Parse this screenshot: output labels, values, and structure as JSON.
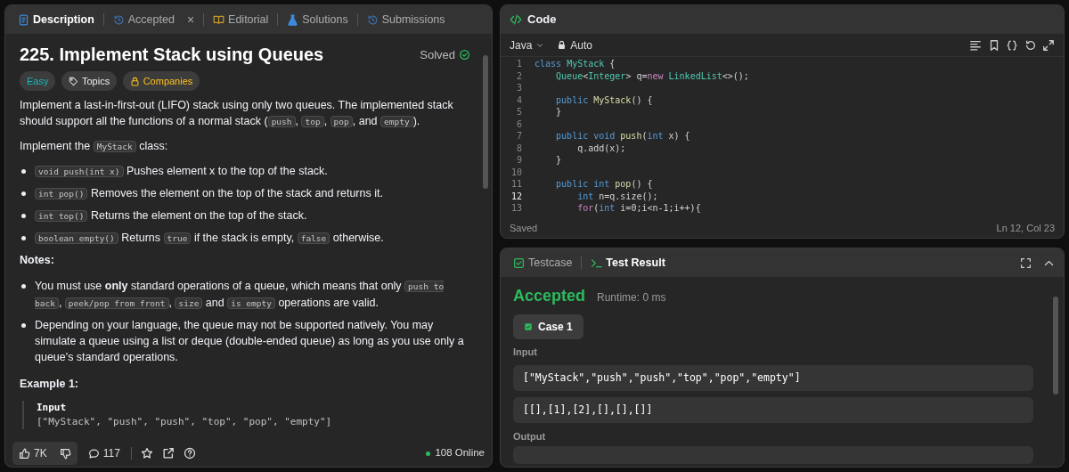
{
  "left_panel": {
    "tabs": [
      {
        "label": "Description",
        "selected": true
      },
      {
        "label": "Accepted",
        "selected": false,
        "close": "×"
      },
      {
        "label": "Editorial",
        "selected": false
      },
      {
        "label": "Solutions",
        "selected": false
      },
      {
        "label": "Submissions",
        "selected": false
      }
    ],
    "title": "225. Implement Stack using Queues",
    "status": "Solved",
    "tags": [
      {
        "label": "Easy",
        "kind": "difficulty"
      },
      {
        "label": "Topics",
        "kind": "topics"
      },
      {
        "label": "Companies",
        "kind": "companies"
      }
    ],
    "content": [
      {
        "kind": "paragraph",
        "segments": [
          {
            "kind": "text",
            "text": "Implement a last-in-first-out (LIFO) stack using only two queues. The implemented stack should support all the functions of a normal stack ("
          },
          {
            "kind": "code",
            "text": "push"
          },
          {
            "kind": "text",
            "text": ", "
          },
          {
            "kind": "code",
            "text": "top"
          },
          {
            "kind": "text",
            "text": ", "
          },
          {
            "kind": "code",
            "text": "pop"
          },
          {
            "kind": "text",
            "text": ", and "
          },
          {
            "kind": "code",
            "text": "empty"
          },
          {
            "kind": "text",
            "text": ")."
          }
        ]
      },
      {
        "kind": "paragraph",
        "segments": [
          {
            "kind": "text",
            "text": "Implement the "
          },
          {
            "kind": "code",
            "text": "MyStack"
          },
          {
            "kind": "text",
            "text": " class:"
          }
        ]
      },
      {
        "kind": "bullet",
        "segments": [
          {
            "kind": "code",
            "text": "void push(int x)"
          },
          {
            "kind": "text",
            "text": " Pushes element x to the top of the stack."
          }
        ]
      },
      {
        "kind": "bullet",
        "segments": [
          {
            "kind": "code",
            "text": "int pop()"
          },
          {
            "kind": "text",
            "text": " Removes the element on the top of the stack and returns it."
          }
        ]
      },
      {
        "kind": "bullet",
        "segments": [
          {
            "kind": "code",
            "text": "int top()"
          },
          {
            "kind": "text",
            "text": " Returns the element on the top of the stack."
          }
        ]
      },
      {
        "kind": "bullet",
        "segments": [
          {
            "kind": "code",
            "text": "boolean empty()"
          },
          {
            "kind": "text",
            "text": " Returns "
          },
          {
            "kind": "code",
            "text": "true"
          },
          {
            "kind": "text",
            "text": " if the stack is empty, "
          },
          {
            "kind": "code",
            "text": "false"
          },
          {
            "kind": "text",
            "text": " otherwise."
          }
        ]
      },
      {
        "kind": "heading",
        "text": "Notes:"
      },
      {
        "kind": "bullet",
        "segments": [
          {
            "kind": "text",
            "text": "You must use **only** standard operations of a queue, which means that only "
          },
          {
            "kind": "code",
            "text": "push to back"
          },
          {
            "kind": "text",
            "text": ", "
          },
          {
            "kind": "code",
            "text": "peek/pop from front"
          },
          {
            "kind": "text",
            "text": ", "
          },
          {
            "kind": "code",
            "text": "size"
          },
          {
            "kind": "text",
            "text": " and "
          },
          {
            "kind": "code",
            "text": "is empty"
          },
          {
            "kind": "text",
            "text": " operations are valid."
          }
        ]
      },
      {
        "kind": "bullet",
        "segments": [
          {
            "kind": "text",
            "text": "Depending on your language, the queue may not be supported natively. You may simulate a queue using a list or deque (double-ended queue) as long as you use only a queue's standard operations."
          }
        ]
      },
      {
        "kind": "heading",
        "text": "Example 1:"
      },
      {
        "kind": "example",
        "label": "Input",
        "value": "[\"MyStack\", \"push\", \"push\", \"top\", \"pop\", \"empty\"]"
      }
    ],
    "footer": {
      "likes": "7K",
      "comments": "117",
      "online": "108 Online"
    }
  },
  "code_panel": {
    "title": "Code",
    "language": "Java",
    "mode": "Auto",
    "lines": [
      {
        "number": "1",
        "current": false,
        "tokens": [
          {
            "kind": "keyword",
            "text": "class "
          },
          {
            "kind": "type",
            "text": "MyStack"
          },
          {
            "kind": "plain",
            "text": " {"
          }
        ]
      },
      {
        "number": "2",
        "current": false,
        "tokens": [
          {
            "kind": "type",
            "text": "    Queue"
          },
          {
            "kind": "plain",
            "text": "<"
          },
          {
            "kind": "type",
            "text": "Integer"
          },
          {
            "kind": "plain",
            "text": "> q="
          },
          {
            "kind": "control",
            "text": "new "
          },
          {
            "kind": "type",
            "text": "LinkedList"
          },
          {
            "kind": "plain",
            "text": "<>();"
          }
        ]
      },
      {
        "number": "3",
        "current": false
      },
      {
        "number": "4",
        "current": false,
        "tokens": [
          {
            "kind": "keyword",
            "text": "    public "
          },
          {
            "kind": "function",
            "text": "MyStack"
          },
          {
            "kind": "plain",
            "text": "() {"
          }
        ]
      },
      {
        "number": "5",
        "current": false,
        "tokens": [
          {
            "kind": "plain",
            "text": "    }"
          }
        ]
      },
      {
        "number": "6",
        "current": false
      },
      {
        "number": "7",
        "current": false,
        "tokens": [
          {
            "kind": "keyword",
            "text": "    public void "
          },
          {
            "kind": "function",
            "text": "push"
          },
          {
            "kind": "plain",
            "text": "("
          },
          {
            "kind": "keyword",
            "text": "int"
          },
          {
            "kind": "plain",
            "text": " x) {"
          }
        ]
      },
      {
        "number": "8",
        "current": false,
        "tokens": [
          {
            "kind": "plain",
            "text": "        q.add(x);"
          }
        ]
      },
      {
        "number": "9",
        "current": false,
        "tokens": [
          {
            "kind": "plain",
            "text": "    }"
          }
        ]
      },
      {
        "number": "10",
        "current": false
      },
      {
        "number": "11",
        "current": false,
        "tokens": [
          {
            "kind": "keyword",
            "text": "    public int "
          },
          {
            "kind": "function",
            "text": "pop"
          },
          {
            "kind": "plain",
            "text": "() {"
          }
        ]
      },
      {
        "number": "12",
        "current": true,
        "tokens": [
          {
            "kind": "keyword",
            "text": "        int"
          },
          {
            "kind": "plain",
            "text": " n=q.size();"
          }
        ]
      },
      {
        "number": "13",
        "current": false,
        "tokens": [
          {
            "kind": "control",
            "text": "        for"
          },
          {
            "kind": "plain",
            "text": "("
          },
          {
            "kind": "keyword",
            "text": "int"
          },
          {
            "kind": "plain",
            "text": " i=0;i<n-1;i++){"
          }
        ]
      }
    ],
    "status": "Saved",
    "cursor": "Ln 12, Col 23"
  },
  "result_panel": {
    "tabs": [
      {
        "label": "Testcase",
        "selected": false
      },
      {
        "label": "Test Result",
        "selected": true
      }
    ],
    "verdict": "Accepted",
    "runtime": "Runtime: 0 ms",
    "cases": [
      {
        "label": "Case 1",
        "selected": true
      }
    ],
    "input_label": "Input",
    "inputs": [
      "[\"MyStack\",\"push\",\"push\",\"top\",\"pop\",\"empty\"]",
      "[[],[1],[2],[],[],[]]"
    ],
    "output_label": "Output"
  }
}
